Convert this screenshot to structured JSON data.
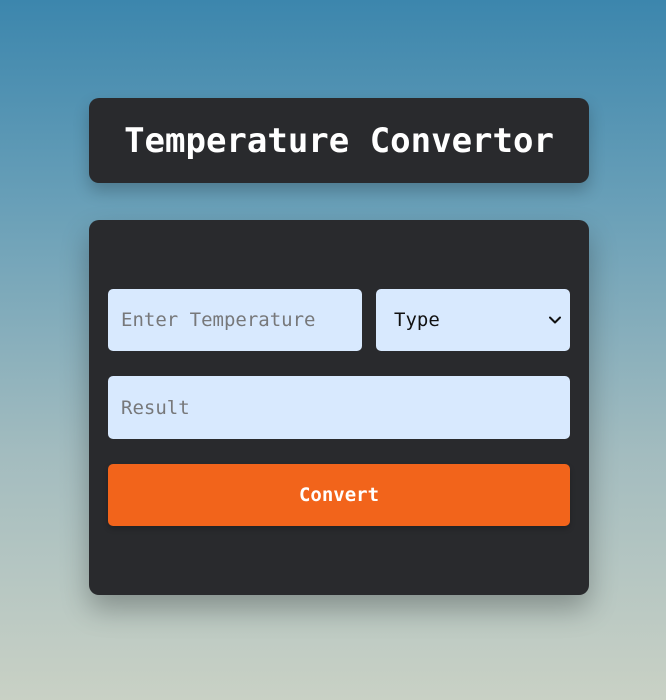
{
  "header": {
    "title": "Temperature Convertor"
  },
  "form": {
    "temperature_placeholder": "Enter Temperature",
    "temperature_value": "",
    "type_selected": "Type",
    "result_placeholder": "Result",
    "result_value": "",
    "convert_label": "Convert"
  },
  "icons": {
    "select_arrow": "chevron-down-icon"
  },
  "colors": {
    "card_background": "#292a2d",
    "field_background": "#d8e9fe",
    "button_accent": "#f2641b",
    "gradient_top": "#3c86ad",
    "gradient_bottom": "#c9d1c5"
  }
}
